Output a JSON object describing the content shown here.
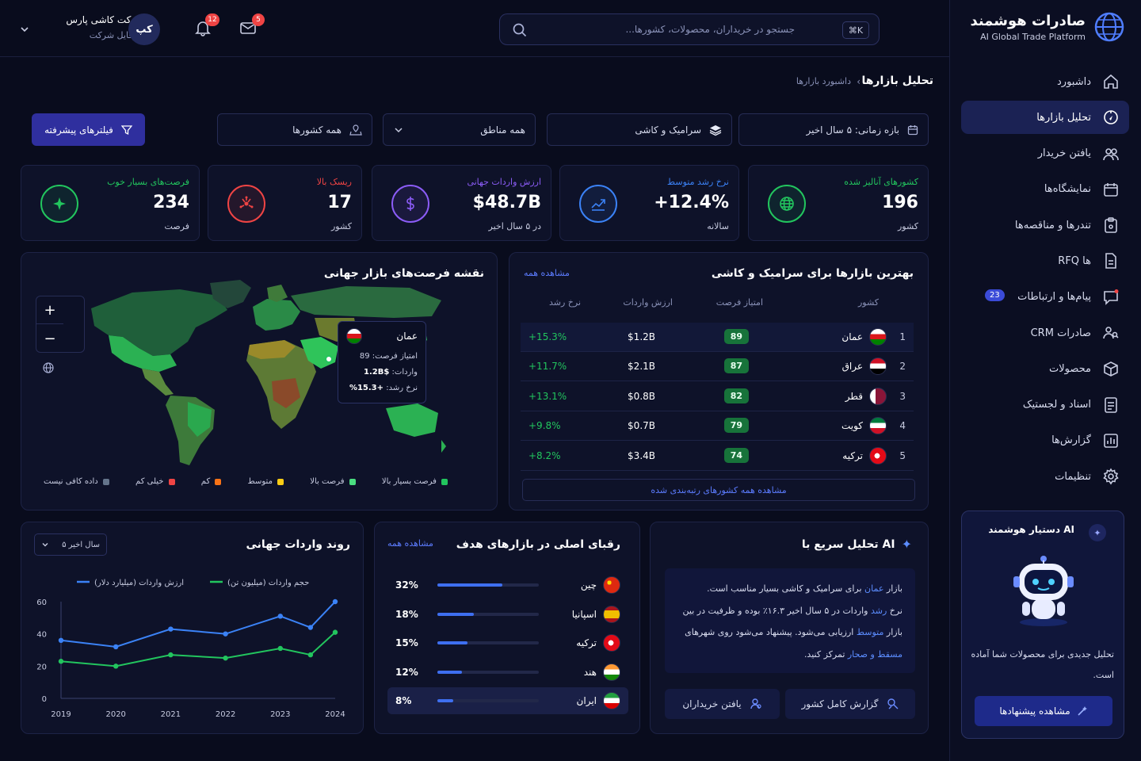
{
  "brand": {
    "name": "صادرات هوشمند",
    "tagline": "AI Global Trade Platform"
  },
  "nav": [
    {
      "label": "داشبورد",
      "icon": "home-icon"
    },
    {
      "label": "تحلیل بازارها",
      "icon": "compass-icon",
      "active": true
    },
    {
      "label": "یافتن خریدار",
      "icon": "users-icon"
    },
    {
      "label": "نمایشگاه‌ها",
      "icon": "calendar-icon"
    },
    {
      "label": "تندرها و مناقصه‌ها",
      "icon": "clipboard-icon"
    },
    {
      "label": "RFQ ها",
      "icon": "document-icon"
    },
    {
      "label": "پیام‌ها و ارتباطات",
      "icon": "message-icon",
      "badge": "23"
    },
    {
      "label": "CRM صادرات",
      "icon": "contacts-icon"
    },
    {
      "label": "محصولات",
      "icon": "box-icon"
    },
    {
      "label": "اسناد و لجستیک",
      "icon": "file-icon"
    },
    {
      "label": "گزارش‌ها",
      "icon": "chart-icon"
    },
    {
      "label": "تنظیمات",
      "icon": "gear-icon"
    }
  ],
  "assistant": {
    "title": "دستیار هوشمند AI",
    "desc": "تحلیل جدیدی برای محصولات شما آماده است.",
    "cta": "مشاهده پیشنهادها"
  },
  "topbar": {
    "company": "شرکت کاشی پارس",
    "profile": "پروفایل شرکت",
    "avatar": "کپ",
    "notif_count": "12",
    "mail_count": "5",
    "search_placeholder": "جستجو در خریداران، محصولات، کشورها...",
    "shortcut": "⌘K"
  },
  "page": {
    "title": "تحلیل بازارها",
    "breadcrumb_parent": "داشبورد بازارها",
    "breadcrumb_sep": "‹"
  },
  "filters": {
    "period": "بازه زمانی: ۵ سال اخیر",
    "product": "سرامیک و کاشی",
    "region": "همه مناطق",
    "countries": "همه کشورها",
    "advanced": "فیلترهای پیشرفته"
  },
  "kpis": [
    {
      "label": "کشورهای آنالیز شده",
      "value": "196",
      "sub": "کشور",
      "color": "#22c55e",
      "icon": "globe-icon"
    },
    {
      "label": "نرخ رشد متوسط",
      "value": "+12.4%",
      "sub": "سالانه",
      "color": "#3b82f6",
      "icon": "trend-icon"
    },
    {
      "label": "ارزش واردات جهانی",
      "value": "$48.7B",
      "sub": "در ۵ سال اخیر",
      "color": "#8b5cf6",
      "icon": "dollar-icon"
    },
    {
      "label": "ریسک بالا",
      "value": "17",
      "sub": "کشور",
      "color": "#ef4444",
      "icon": "risk-icon"
    },
    {
      "label": "فرصت‌های بسیار خوب",
      "value": "234",
      "sub": "فرصت",
      "color": "#22c55e",
      "icon": "target-icon"
    }
  ],
  "top_markets": {
    "title": "بهترین بازارها برای سرامیک و کاشی",
    "view_all": "مشاهده همه",
    "headers": [
      "کشور",
      "امتیاز فرصت",
      "ارزش واردات",
      "نرخ رشد"
    ],
    "rows": [
      {
        "rank": "1",
        "country": "عمان",
        "score": "89",
        "value": "$1.2B",
        "growth": "+15.3%"
      },
      {
        "rank": "2",
        "country": "عراق",
        "score": "87",
        "value": "$2.1B",
        "growth": "+11.7%"
      },
      {
        "rank": "3",
        "country": "قطر",
        "score": "82",
        "value": "$0.8B",
        "growth": "+13.1%"
      },
      {
        "rank": "4",
        "country": "کویت",
        "score": "79",
        "value": "$0.7B",
        "growth": "+9.8%"
      },
      {
        "rank": "5",
        "country": "ترکیه",
        "score": "74",
        "value": "$3.4B",
        "growth": "+8.2%"
      }
    ],
    "footer": "مشاهده همه کشورهای رتبه‌بندی شده"
  },
  "map": {
    "title": "نقشه فرصت‌های بازار جهانی",
    "zoom_in": "+",
    "zoom_out": "−",
    "tooltip": {
      "country": "عمان",
      "score_label": "امتیاز فرصت:",
      "score": "89",
      "value_label": "واردات:",
      "value": "$1.2B",
      "growth_label": "نرخ رشد:",
      "growth": "+15.3%"
    },
    "legend": [
      {
        "label": "فرصت بسیار بالا",
        "color": "#22c55e"
      },
      {
        "label": "فرصت بالا",
        "color": "#4ade80"
      },
      {
        "label": "متوسط",
        "color": "#facc15"
      },
      {
        "label": "کم",
        "color": "#f97316"
      },
      {
        "label": "خیلی کم",
        "color": "#ef4444"
      },
      {
        "label": "داده کافی نیست",
        "color": "#64748b"
      }
    ]
  },
  "trend": {
    "title": "روند واردات جهانی",
    "period": "۵ سال اخیر"
  },
  "chart_data": {
    "type": "line",
    "title": "روند واردات جهانی",
    "x": [
      "2019",
      "2020",
      "2021",
      "2022",
      "2023",
      "2024"
    ],
    "ylim": [
      0,
      60
    ],
    "yticks": [
      "0",
      "20",
      "40",
      "60"
    ],
    "series": [
      {
        "name": "ارزش واردات (میلیارد دلار)",
        "color": "#3b82f6",
        "values": [
          36,
          32,
          43,
          40,
          51,
          44,
          60
        ]
      },
      {
        "name": "حجم واردات (میلیون تن)",
        "color": "#22c55e",
        "values": [
          23,
          20,
          27,
          25,
          31,
          27,
          41
        ]
      }
    ],
    "x_positions": [
      2019,
      2020,
      2021,
      2022,
      2023,
      2023.55,
      2024
    ]
  },
  "competitors": {
    "title": "رقبای اصلی در بازارهای هدف",
    "view_all": "مشاهده همه",
    "rows": [
      {
        "country": "چین",
        "share": "32%",
        "pct": 32
      },
      {
        "country": "اسپانیا",
        "share": "18%",
        "pct": 18
      },
      {
        "country": "ترکیه",
        "share": "15%",
        "pct": 15
      },
      {
        "country": "هند",
        "share": "12%",
        "pct": 12
      },
      {
        "country": "ایران",
        "share": "8%",
        "pct": 8
      }
    ]
  },
  "ai_quick": {
    "title": "تحلیل سریع با AI",
    "lines": [
      {
        "pre": "بازار ",
        "hl": "عمان",
        "post": " برای سرامیک و کاشی بسیار مناسب است."
      },
      {
        "pre": "نرخ ",
        "hl": "رشد",
        "post": " واردات در ۵ سال اخیر ۱۶.۳٪ بوده و ظرفیت در بین"
      },
      {
        "pre": "بازار ",
        "hl": "متوسط",
        "post": " ارزیابی می‌شود. پیشنهاد می‌شود روی شهرهای"
      },
      {
        "pre": "",
        "hl": "مسقط و صحار",
        "post": " تمرکز کنید."
      }
    ],
    "btn_report": "گزارش کامل کشور",
    "btn_buyers": "یافتن خریداران"
  }
}
